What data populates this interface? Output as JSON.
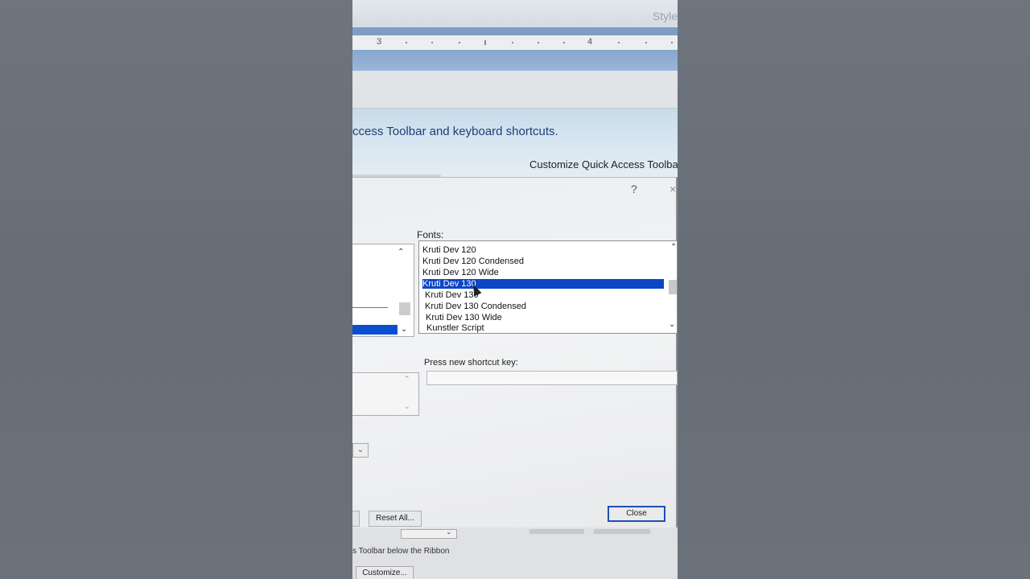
{
  "top": {
    "styles_hint": "Style"
  },
  "ruler": {
    "mark_3": "3",
    "mark_4": "4"
  },
  "banner": {
    "message": "ccess Toolbar and keyboard shortcuts.",
    "customize_qat": "Customize Quick Access Toolba"
  },
  "dialog": {
    "help_glyph": "?",
    "close_glyph": "×",
    "fonts_label": "Fonts:",
    "fonts": [
      "Kruti Dev 120",
      "Kruti Dev 120 Condensed",
      "Kruti Dev 120 Wide",
      "Kruti Dev 130",
      "Kruti Dev 130",
      "Kruti Dev 130 Condensed",
      "Kruti Dev 130 Wide",
      "Kunstler Script"
    ],
    "selected_index": 3,
    "press_new_shortcut_label": "Press new shortcut key:",
    "press_new_shortcut_value": "",
    "reset_all": "Reset All...",
    "close": "Close"
  },
  "below": {
    "toolbar_below_ribbon": "s Toolbar below the Ribbon",
    "customize": "Customize..."
  },
  "colors": {
    "selection": "#0b46c4",
    "banner_text": "#1d3f7a"
  }
}
